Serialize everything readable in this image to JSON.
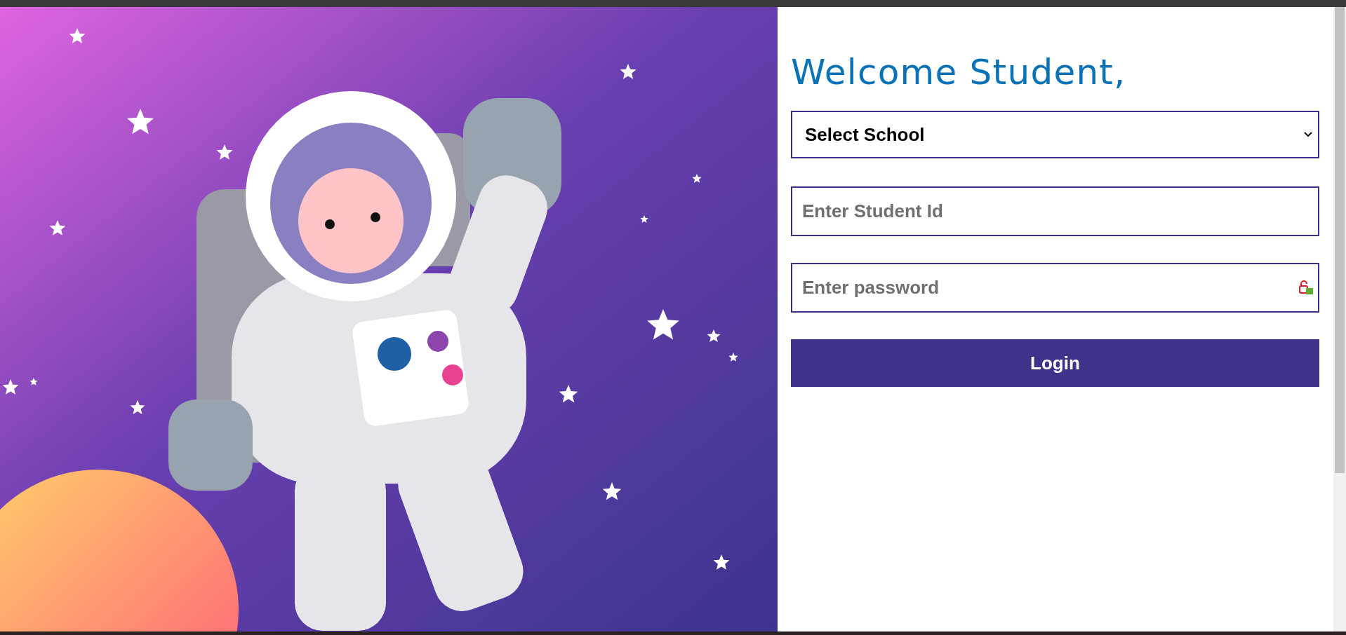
{
  "heading": "Welcome Student,",
  "form": {
    "school_select": {
      "value": "Select School"
    },
    "student_id": {
      "placeholder": "Enter Student Id"
    },
    "password": {
      "placeholder": "Enter password"
    },
    "submit": "Login"
  }
}
